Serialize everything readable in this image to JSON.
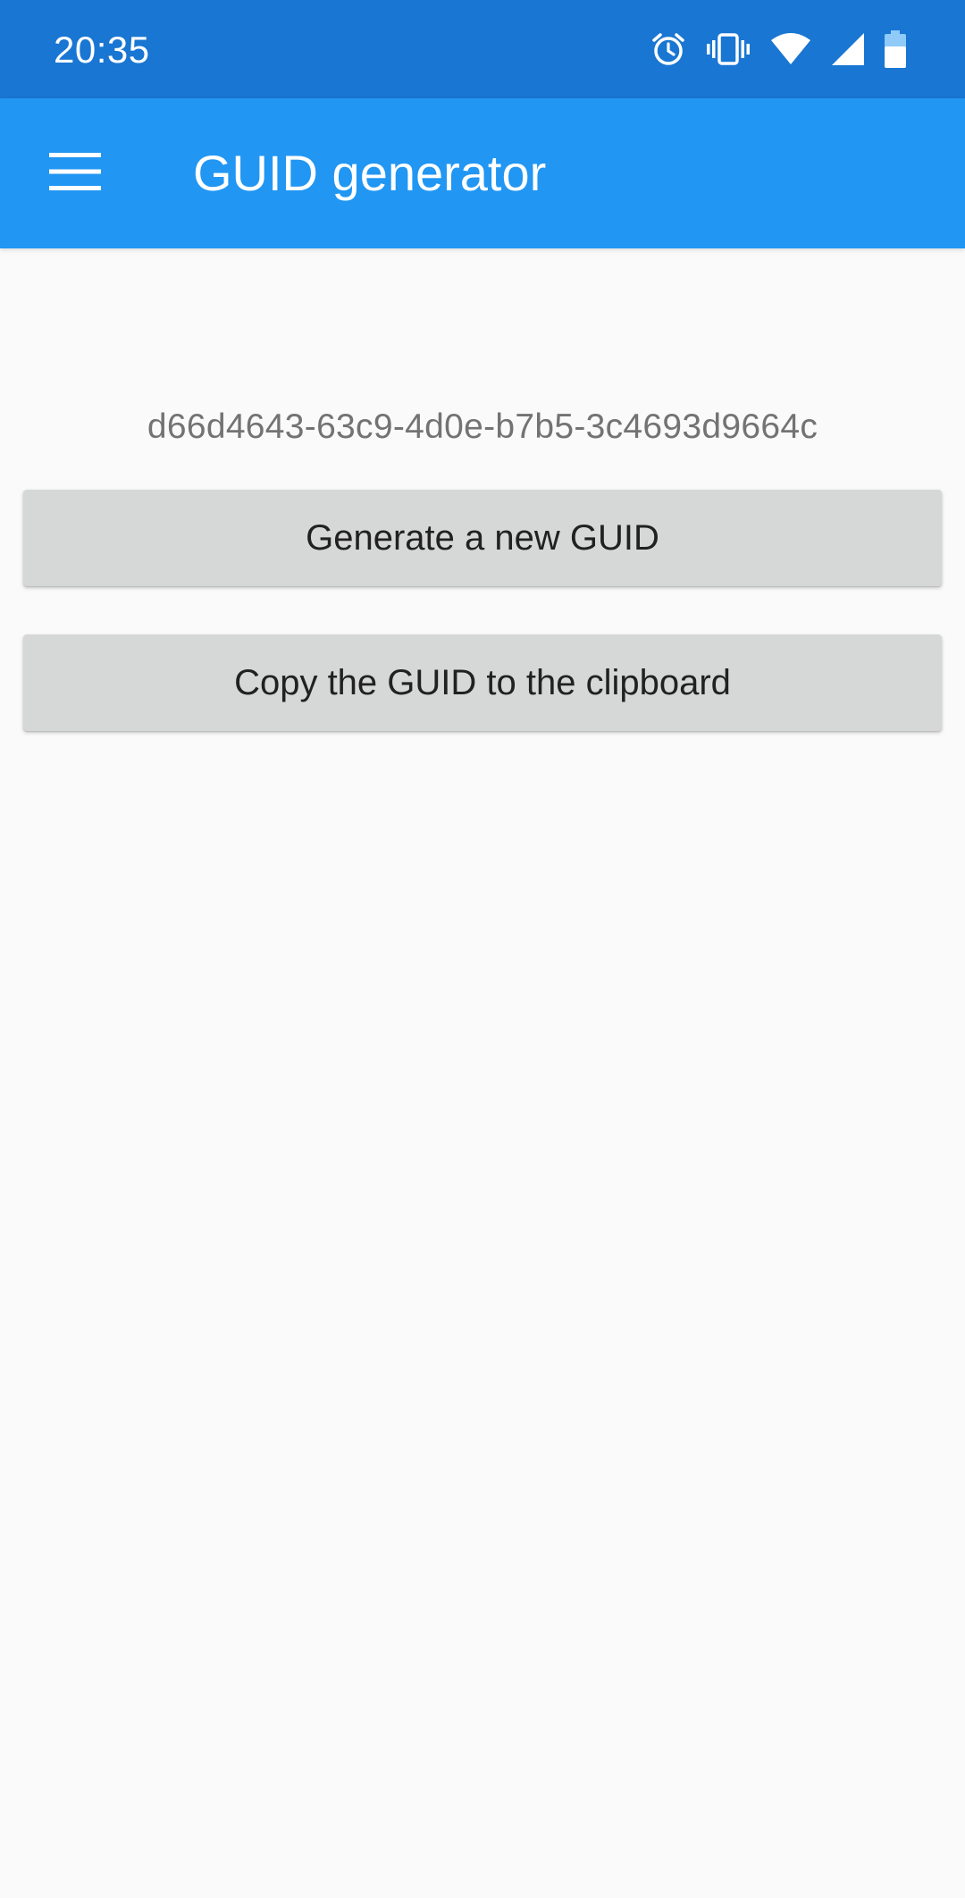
{
  "status_bar": {
    "time": "20:35",
    "icons": [
      "alarm-icon",
      "vibrate-icon",
      "wifi-icon",
      "signal-icon",
      "battery-icon"
    ]
  },
  "app_bar": {
    "title": "GUID generator",
    "menu_icon": "hamburger-menu-icon"
  },
  "main": {
    "guid": "d66d4643-63c9-4d0e-b7b5-3c4693d9664c",
    "generate_button_label": "Generate a new GUID",
    "copy_button_label": "Copy the GUID to the clipboard"
  },
  "colors": {
    "status_bar_bg": "#1976d2",
    "app_bar_bg": "#2196f3",
    "button_bg": "#d6d7d7",
    "page_bg": "#fafafa"
  }
}
